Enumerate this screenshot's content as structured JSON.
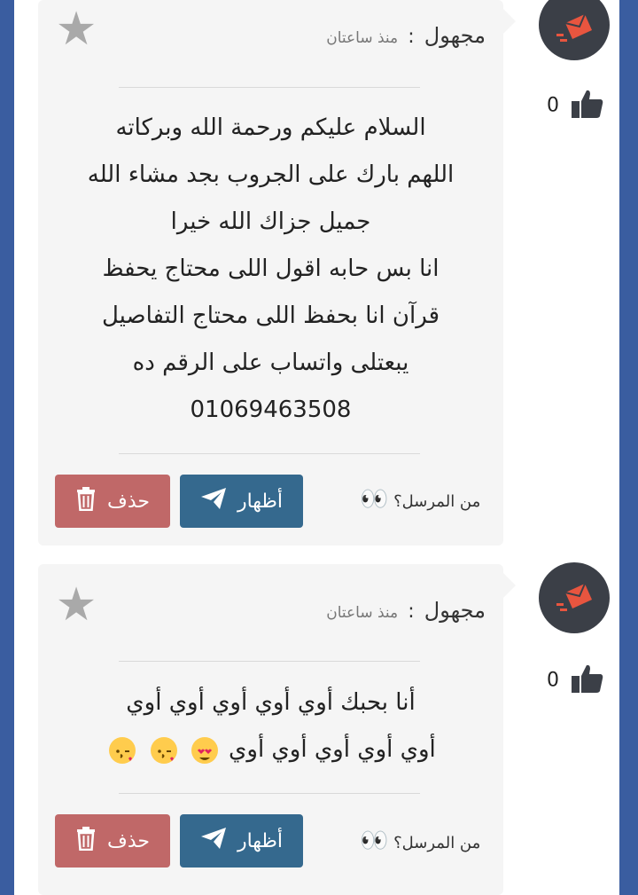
{
  "posts": [
    {
      "author": "مجهول",
      "separator": ":",
      "time": "منذ ساعتان",
      "lines": [
        "السلام عليكم ورحمة الله وبركاته",
        "اللهم بارك على الجروب بجد مشاء الله",
        "جميل جزاك الله خيرا",
        "انا بس حابه اقول اللى محتاج يحفظ",
        "قرآن انا بحفظ اللى محتاج التفاصيل",
        "يبعتلى واتساب على الرقم ده",
        "01069463508"
      ],
      "show_label": "أظهار",
      "delete_label": "حذف",
      "sender_label": "من المرسل؟",
      "likes": "0"
    },
    {
      "author": "مجهول",
      "separator": ":",
      "time": "منذ ساعتان",
      "lines": [
        "أنا بحبك أوي أوي أوي أوي أوي",
        "أوي أوي أوي أوي أوي"
      ],
      "show_label": "أظهار",
      "delete_label": "حذف",
      "sender_label": "من المرسل؟",
      "likes": "0"
    }
  ],
  "colors": {
    "background": "#3a5da0",
    "card": "#f5f5f5",
    "show_button": "#35698e",
    "delete_button": "#c06868",
    "avatar": "#3b3f47",
    "avatar_icon": "#e8553f"
  },
  "icons": {
    "favorite": "star-icon",
    "like": "thumbs-up-icon",
    "show": "paper-plane-icon",
    "delete": "trash-icon",
    "sender": "eyes-icon",
    "avatar": "envelope-icon"
  }
}
